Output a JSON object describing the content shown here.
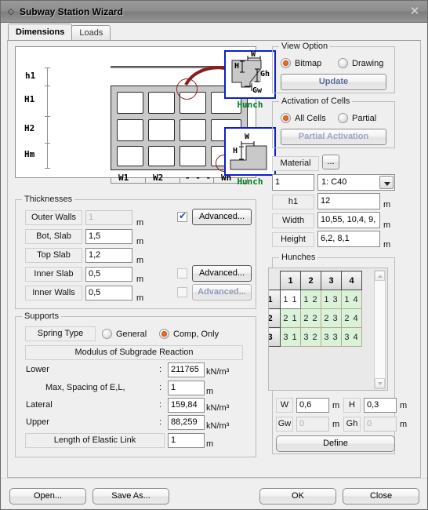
{
  "window": {
    "title": "Subway Station Wizard",
    "sysmenu_icon": "diamond-icon",
    "close_icon": "✕"
  },
  "tabs": [
    {
      "label": "Dimensions",
      "active": true
    },
    {
      "label": "Loads",
      "active": false
    }
  ],
  "diagram": {
    "labels": {
      "h1": "h1",
      "H1": "H1",
      "H2": "H2",
      "Hm": "Hm",
      "W1": "W1",
      "W2": "W2",
      "dots": "- - -",
      "Wn": "Wn"
    },
    "hunch_top": {
      "caption": "Hunch",
      "W": "W",
      "H": "H",
      "Gh": "Gh",
      "Gw": "Gw"
    },
    "hunch_bottom": {
      "caption": "Hunch",
      "W": "W",
      "H": "H"
    }
  },
  "view_option": {
    "title": "View Option",
    "radios": [
      {
        "label": "Bitmap",
        "selected": true
      },
      {
        "label": "Drawing",
        "selected": false
      }
    ],
    "update_button": "Update"
  },
  "activation": {
    "title": "Activation of Cells",
    "radios": [
      {
        "label": "All Cells",
        "selected": true
      },
      {
        "label": "Partial",
        "selected": false
      }
    ],
    "partial_button": "Partial Activation"
  },
  "material": {
    "label": "Material",
    "browse_button": "...",
    "id_value": "1",
    "combo_value": "1: C40",
    "rows": [
      {
        "label": "h1",
        "value": "12",
        "unit": "m"
      },
      {
        "label": "Width",
        "value": "10,55, 10,4, 9,",
        "unit": "m"
      },
      {
        "label": "Height",
        "value": "6,2, 8,1",
        "unit": "m"
      }
    ]
  },
  "hunches": {
    "title": "Hunches",
    "col_headers": [
      "1",
      "2",
      "3",
      "4"
    ],
    "row_headers": [
      "1",
      "2",
      "3"
    ],
    "cells": [
      [
        "1 1",
        "1 2",
        "1 3",
        "1 4"
      ],
      [
        "2 1",
        "2 2",
        "2 3",
        "2 4"
      ],
      [
        "3 1",
        "3 2",
        "3 3",
        "3 4"
      ]
    ],
    "selected_cell": "1 1",
    "fields": [
      {
        "label": "W",
        "value": "0,6",
        "unit": "m",
        "disabled": false
      },
      {
        "label": "H",
        "value": "0,3",
        "unit": "m",
        "disabled": false
      },
      {
        "label": "Gw",
        "value": "0",
        "unit": "m",
        "disabled": true
      },
      {
        "label": "Gh",
        "value": "0",
        "unit": "m",
        "disabled": true
      }
    ],
    "define_button": "Define"
  },
  "thicknesses": {
    "title": "Thicknesses",
    "rows": [
      {
        "label": "Outer Walls",
        "value": "1",
        "unit": "m",
        "disabled": true,
        "checkbox": "checked",
        "advanced": "Advanced...",
        "advanced_enabled": true
      },
      {
        "label": "Bot, Slab",
        "value": "1,5",
        "unit": "m",
        "disabled": false,
        "checkbox": "none",
        "advanced": "",
        "advanced_enabled": false
      },
      {
        "label": "Top Slab",
        "value": "1,2",
        "unit": "m",
        "disabled": false,
        "checkbox": "none",
        "advanced": "",
        "advanced_enabled": false
      },
      {
        "label": "Inner Slab",
        "value": "0,5",
        "unit": "m",
        "disabled": false,
        "checkbox": "unchecked",
        "advanced": "Advanced...",
        "advanced_enabled": true
      },
      {
        "label": "Inner Walls",
        "value": "0,5",
        "unit": "m",
        "disabled": false,
        "checkbox": "unchecked",
        "advanced": "Advanced...",
        "advanced_enabled": false
      }
    ]
  },
  "supports": {
    "title": "Supports",
    "spring_type_label": "Spring Type",
    "spring_radios": [
      {
        "label": "General",
        "selected": false
      },
      {
        "label": "Comp, Only",
        "selected": true
      }
    ],
    "modulus_header": "Modulus of Subgrade Reaction",
    "rows": [
      {
        "label": "Lower",
        "colon": ":",
        "value": "211765",
        "unit": "kN/m³",
        "indent": false
      },
      {
        "label": "Max, Spacing of E,L,",
        "colon": ":",
        "value": "1",
        "unit": "m",
        "indent": true
      },
      {
        "label": "Lateral",
        "colon": ":",
        "value": "159,84",
        "unit": "kN/m³",
        "indent": false
      },
      {
        "label": "Upper",
        "colon": ":",
        "value": "88,259",
        "unit": "kN/m³",
        "indent": false
      }
    ],
    "elastic_link_label": "Length of Elastic Link",
    "elastic_link_value": "1",
    "elastic_link_unit": "m"
  },
  "footer": {
    "open_button": "Open...",
    "saveas_button": "Save As...",
    "ok_button": "OK",
    "close_button": "Close"
  }
}
